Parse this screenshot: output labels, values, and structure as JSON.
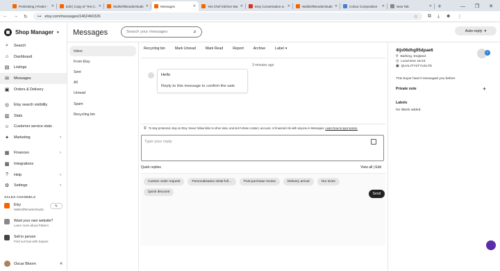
{
  "browser": {
    "tabs": [
      {
        "label": "Printivising | Poster -",
        "color": "#f56400",
        "active": false
      },
      {
        "label": "Edit | Copy of 'Yes C…",
        "color": "#f56400",
        "active": false
      },
      {
        "label": "WallsOfWonderStudio",
        "color": "#f56400",
        "active": false
      },
      {
        "label": "Messages",
        "color": "#f56400",
        "active": true
      },
      {
        "label": "Yes Chef Kitchen Wa…",
        "color": "#f56400",
        "active": false
      },
      {
        "label": "Etsy Conversation w…",
        "color": "#d93025",
        "active": false
      },
      {
        "label": "WallsOfWonderStudio",
        "color": "#f56400",
        "active": false
      },
      {
        "label": "Colour Composition",
        "color": "#4a7bd6",
        "active": false
      },
      {
        "label": "New Tab",
        "color": "#888888",
        "active": false
      }
    ],
    "url": "etsy.com/messages/1462460326"
  },
  "sidebar": {
    "brand": "Shop Manager",
    "items": [
      {
        "label": "Search",
        "icon": "search-icon",
        "glyph": "⌕"
      },
      {
        "label": "Dashboard",
        "icon": "home-icon",
        "glyph": "⌂"
      },
      {
        "label": "Listings",
        "icon": "listings-icon",
        "glyph": "▤"
      },
      {
        "label": "Messages",
        "icon": "messages-icon",
        "glyph": "✉",
        "active": true
      },
      {
        "label": "Orders & Delivery",
        "icon": "orders-icon",
        "glyph": "▣"
      },
      {
        "label": "Etsy search visibility",
        "icon": "visibility-icon",
        "glyph": "◎"
      },
      {
        "label": "Stats",
        "icon": "stats-icon",
        "glyph": "▥"
      },
      {
        "label": "Customer service stats",
        "icon": "customer-service-icon",
        "glyph": "☺"
      },
      {
        "label": "Marketing",
        "icon": "marketing-icon",
        "glyph": "✦",
        "chevron": true
      },
      {
        "label": "Finances",
        "icon": "finances-icon",
        "glyph": "▦",
        "chevron": true
      },
      {
        "label": "Integrations",
        "icon": "integrations-icon",
        "glyph": "▩"
      },
      {
        "label": "Help",
        "icon": "help-icon",
        "glyph": "?",
        "chevron": true
      },
      {
        "label": "Settings",
        "icon": "settings-icon",
        "glyph": "⚙",
        "chevron": true
      }
    ],
    "sales_channels_label": "SALES CHANNELS",
    "channels": [
      {
        "title": "Etsy",
        "sub": "WallsOfWonderStudio",
        "color": "#f56400"
      },
      {
        "title": "Want your own website?",
        "sub": "Learn more about Pattern",
        "color": "#888888"
      },
      {
        "title": "Sell in person",
        "sub": "Find out how with Square",
        "color": "#444444"
      }
    ],
    "user_name": "Oscar Bloom"
  },
  "main": {
    "title": "Messages",
    "search_placeholder": "Search your messages",
    "auto_reply": "Auto-reply",
    "folders": [
      "Inbox",
      "From Etsy",
      "Sent",
      "All",
      "Unread",
      "Spam",
      "Recycling bin"
    ],
    "toolbar": [
      "Recycling bin",
      "Mark Unread",
      "Mark Read",
      "Report",
      "Archive",
      "Label"
    ],
    "timestamp": "3 minutes ago",
    "message_line1": "Hello",
    "message_line2": "Reply to this message to confirm the sale",
    "notice_text": "To stay protected, stay on Etsy. Never follow links to other sites, and don't share contact, account, or financial info with anyone in Messages.",
    "notice_link": "Learn how to spot scams.",
    "reply_placeholder": "Type your reply",
    "quick_replies_label": "Quick replies",
    "view_all": "View all | Edit",
    "quick_replies": [
      "Custom order request",
      "Personalisation initial foll…",
      "Post-purchase review",
      "Delivery arrival",
      "Our sizes",
      "Quick discount"
    ],
    "send": "Send"
  },
  "profile": {
    "username": "4tjv06dhg95dpae6",
    "location": "Barking, England",
    "local_time": "Local time 18:23",
    "shop": "QUALITYSTYLELTD",
    "first_message": "This buyer hasn't messaged you before",
    "private_note": "Private note",
    "labels_heading": "Labels",
    "no_labels": "No labels added."
  }
}
